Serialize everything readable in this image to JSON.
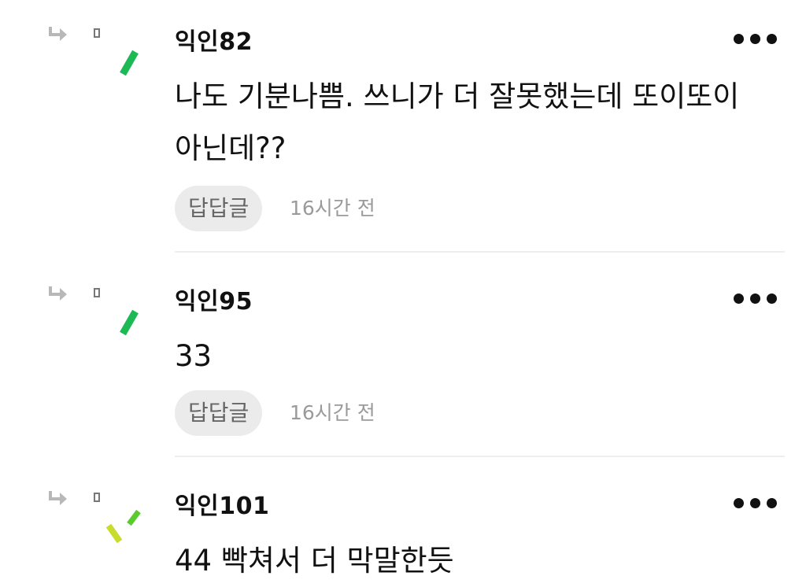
{
  "comments": [
    {
      "author": "익인82",
      "text": "나도 기분나쁨. 쓰니가 더 잘못했는데 또이또이 아닌데??",
      "reply_label": "답답글",
      "timestamp": "16시간 전",
      "mark_colors": [
        "#1db954"
      ]
    },
    {
      "author": "익인95",
      "text": "33",
      "reply_label": "답답글",
      "timestamp": "16시간 전",
      "mark_colors": [
        "#1db954"
      ]
    },
    {
      "author": "익인101",
      "text": "44 빡쳐서 더 막말한듯",
      "mark_colors": [
        "#c8dc2e",
        "#5acb2e"
      ]
    }
  ],
  "icons": {
    "reply": "reply-arrow-icon",
    "more": "more-options-icon"
  }
}
